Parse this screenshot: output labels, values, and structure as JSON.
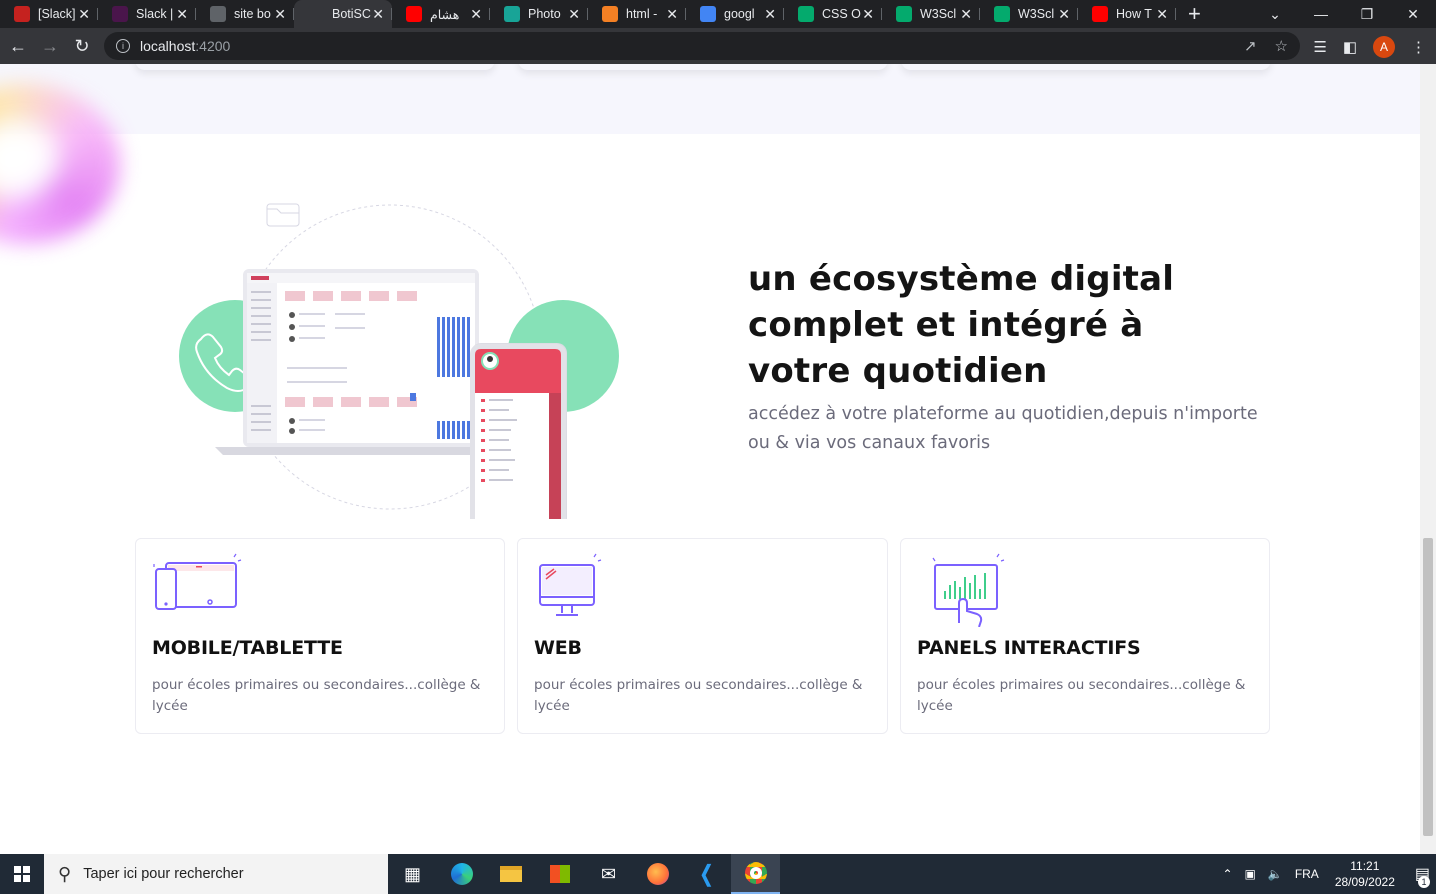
{
  "browser": {
    "tabs": [
      {
        "title": "[Slack]",
        "favicon": "gmail-icon",
        "color": "#c5221f"
      },
      {
        "title": "Slack |",
        "favicon": "slack-icon",
        "color": "#4a154b"
      },
      {
        "title": "site bo",
        "favicon": "globe-icon",
        "color": "#5f6368"
      },
      {
        "title": "BotiSC",
        "favicon": "angular-icon",
        "color": "#35363a",
        "active": true
      },
      {
        "title": "هشام",
        "favicon": "youtube-icon",
        "color": "#ff0000"
      },
      {
        "title": "Photo",
        "favicon": "photopea-icon",
        "color": "#18a497"
      },
      {
        "title": "html -",
        "favicon": "stackoverflow-icon",
        "color": "#f48024"
      },
      {
        "title": "googl",
        "favicon": "google-icon",
        "color": "#4285f4"
      },
      {
        "title": "CSS O",
        "favicon": "w3schools-icon",
        "color": "#04aa6d"
      },
      {
        "title": "W3Scl",
        "favicon": "w3schools-icon",
        "color": "#04aa6d"
      },
      {
        "title": "W3Scl",
        "favicon": "w3schools-icon",
        "color": "#04aa6d"
      },
      {
        "title": "How T",
        "favicon": "youtube-icon",
        "color": "#ff0000"
      }
    ],
    "url_host": "localhost",
    "url_port": ":4200",
    "profile_initial": "A"
  },
  "hero": {
    "title_line1": "un écosystème digital",
    "title_line2": "complet et intégré à",
    "title_line3": "votre quotidien",
    "subtitle_line1": "accédez à votre plateforme au quotidien,depuis n'importe",
    "subtitle_line2": "ou & via vos canaux favoris"
  },
  "cards": [
    {
      "title": "MOBILE/TABLETTE",
      "desc": "pour écoles primaires ou secondaires...collège & lycée",
      "icon": "tablet-phone-icon"
    },
    {
      "title": "WEB",
      "desc": "pour écoles primaires ou secondaires...collège & lycée",
      "icon": "monitor-icon"
    },
    {
      "title": "PANELS INTERACTIFS",
      "desc": "pour écoles primaires ou secondaires...collège & lycée",
      "icon": "interactive-panel-icon"
    }
  ],
  "taskbar": {
    "search_placeholder": "Taper ici pour rechercher",
    "language": "FRA",
    "time": "11:21",
    "date": "28/09/2022",
    "notification_count": "1"
  },
  "colors": {
    "accent_purple": "#7b61ff",
    "accent_green": "#7ee2b8",
    "accent_pink": "#e8495f"
  }
}
